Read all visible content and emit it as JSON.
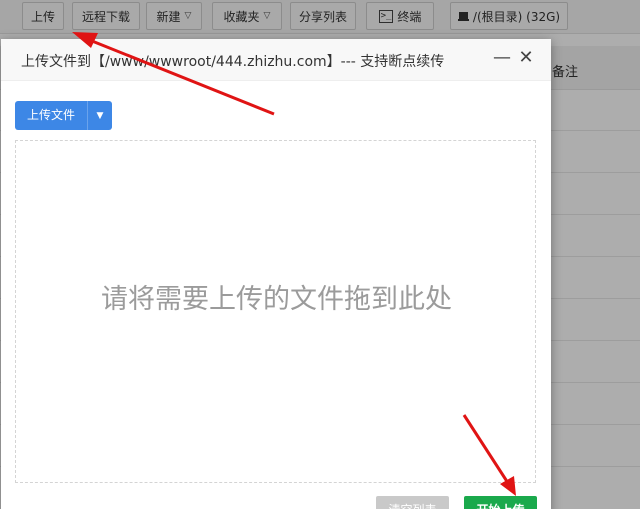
{
  "toolbar": {
    "upload": "上传",
    "remote_download": "远程下载",
    "new": "新建",
    "favorites": "收藏夹",
    "share_list": "分享列表",
    "terminal": "终端",
    "terminal_icon_text": ">_",
    "disk": "/(根目录) (32G)"
  },
  "table": {
    "remark_header": "备注"
  },
  "modal": {
    "title": "上传文件到【/www/wwwroot/444.zhizhu.com】--- 支持断点续传",
    "minimize_glyph": "—",
    "close_glyph": "✕",
    "upload_button": "上传文件",
    "dropzone_text": "请将需要上传的文件拖到此处",
    "clear_button": "清空列表",
    "start_button": "开始上传"
  },
  "colors": {
    "accent_blue": "#3d87e6",
    "start_green": "#1aa94c",
    "arrow_red": "#e01414"
  },
  "icons": [
    "chevron-down-icon",
    "terminal-icon",
    "disk-icon",
    "caret-down-icon",
    "minimize-icon",
    "close-icon",
    "arrow-annotation"
  ]
}
